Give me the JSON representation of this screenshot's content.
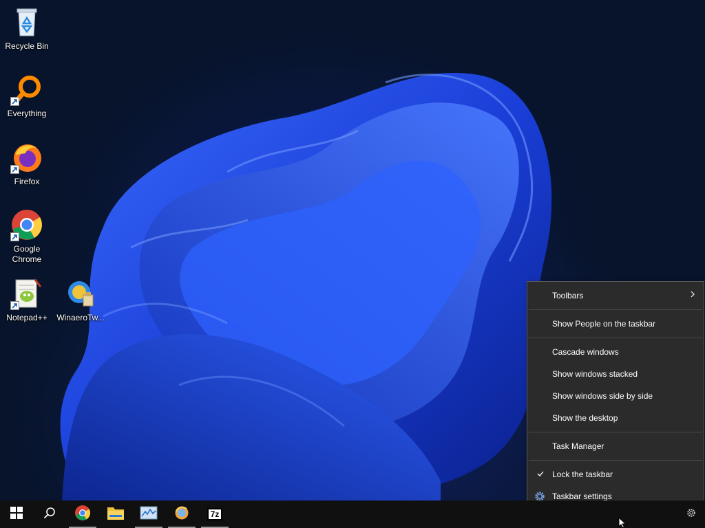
{
  "desktop_icons": [
    {
      "name": "recycle-bin",
      "label": "Recycle Bin"
    },
    {
      "name": "everything",
      "label": "Everything"
    },
    {
      "name": "firefox",
      "label": "Firefox"
    },
    {
      "name": "google-chrome",
      "label": "Google Chrome"
    },
    {
      "name": "notepadpp",
      "label": "Notepad++"
    },
    {
      "name": "winaerotweaker",
      "label": "WinaeroTw..."
    }
  ],
  "context_menu": {
    "toolbars": "Toolbars",
    "show_people": "Show People on the taskbar",
    "cascade": "Cascade windows",
    "stacked": "Show windows stacked",
    "side_by_side": "Show windows side by side",
    "show_desktop": "Show the desktop",
    "task_manager": "Task Manager",
    "lock_taskbar": "Lock the taskbar",
    "lock_checked": true,
    "taskbar_settings": "Taskbar settings"
  },
  "taskbar": {
    "pinned": [
      {
        "name": "chrome",
        "running": true
      },
      {
        "name": "file-explorer",
        "running": false
      },
      {
        "name": "resource-monitor",
        "running": true
      },
      {
        "name": "firefox-like",
        "running": true
      },
      {
        "name": "7zip",
        "running": true
      }
    ],
    "seven_zip_label": "7z"
  },
  "colors": {
    "menu_bg": "#2b2b2b",
    "taskbar_bg": "#101010",
    "accent_blue": "#1f4fe0"
  }
}
